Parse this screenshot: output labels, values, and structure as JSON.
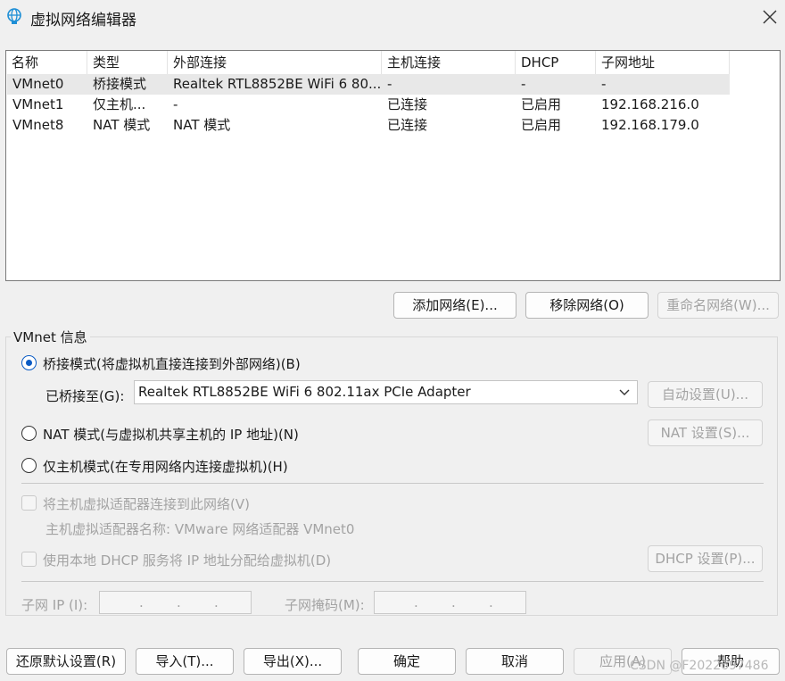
{
  "window": {
    "title": "虚拟网络编辑器"
  },
  "table": {
    "columns": [
      "名称",
      "类型",
      "外部连接",
      "主机连接",
      "DHCP",
      "子网地址"
    ],
    "rows": [
      {
        "name": "VMnet0",
        "type": "桥接模式",
        "external": "Realtek RTL8852BE WiFi 6 80...",
        "host": "-",
        "dhcp": "-",
        "subnet": "-"
      },
      {
        "name": "VMnet1",
        "type": "仅主机...",
        "external": "-",
        "host": "已连接",
        "dhcp": "已启用",
        "subnet": "192.168.216.0"
      },
      {
        "name": "VMnet8",
        "type": "NAT 模式",
        "external": "NAT 模式",
        "host": "已连接",
        "dhcp": "已启用",
        "subnet": "192.168.179.0"
      }
    ]
  },
  "table_actions": {
    "add": "添加网络(E)...",
    "remove": "移除网络(O)",
    "rename": "重命名网络(W)..."
  },
  "info": {
    "group_title": "VMnet 信息",
    "bridged_label": "桥接模式(将虚拟机直接连接到外部网络)(B)",
    "bridged_to_label": "已桥接至(G):",
    "bridged_to_value": "Realtek RTL8852BE WiFi 6 802.11ax PCIe Adapter",
    "auto_settings": "自动设置(U)...",
    "nat_label": "NAT 模式(与虚拟机共享主机的 IP 地址)(N)",
    "nat_settings": "NAT 设置(S)...",
    "hostonly_label": "仅主机模式(在专用网络内连接虚拟机)(H)",
    "connect_adapter_label": "将主机虚拟适配器连接到此网络(V)",
    "adapter_name_text": "主机虚拟适配器名称: VMware 网络适配器 VMnet0",
    "dhcp_label": "使用本地 DHCP 服务将 IP 地址分配给虚拟机(D)",
    "dhcp_settings": "DHCP 设置(P)...",
    "subnet_ip_label": "子网 IP (I):",
    "subnet_mask_label": "子网掩码(M):",
    "selected_mode": "bridged"
  },
  "footer": {
    "restore": "还原默认设置(R)",
    "import": "导入(T)...",
    "export": "导出(X)...",
    "ok": "确定",
    "cancel": "取消",
    "apply": "应用(A)",
    "help": "帮助"
  },
  "watermark": "CSDN @F2022697486",
  "colors": {
    "accent": "#0a5bc4",
    "disabled_text": "#a3a3a3",
    "selected_row": "#e8e8e8"
  }
}
